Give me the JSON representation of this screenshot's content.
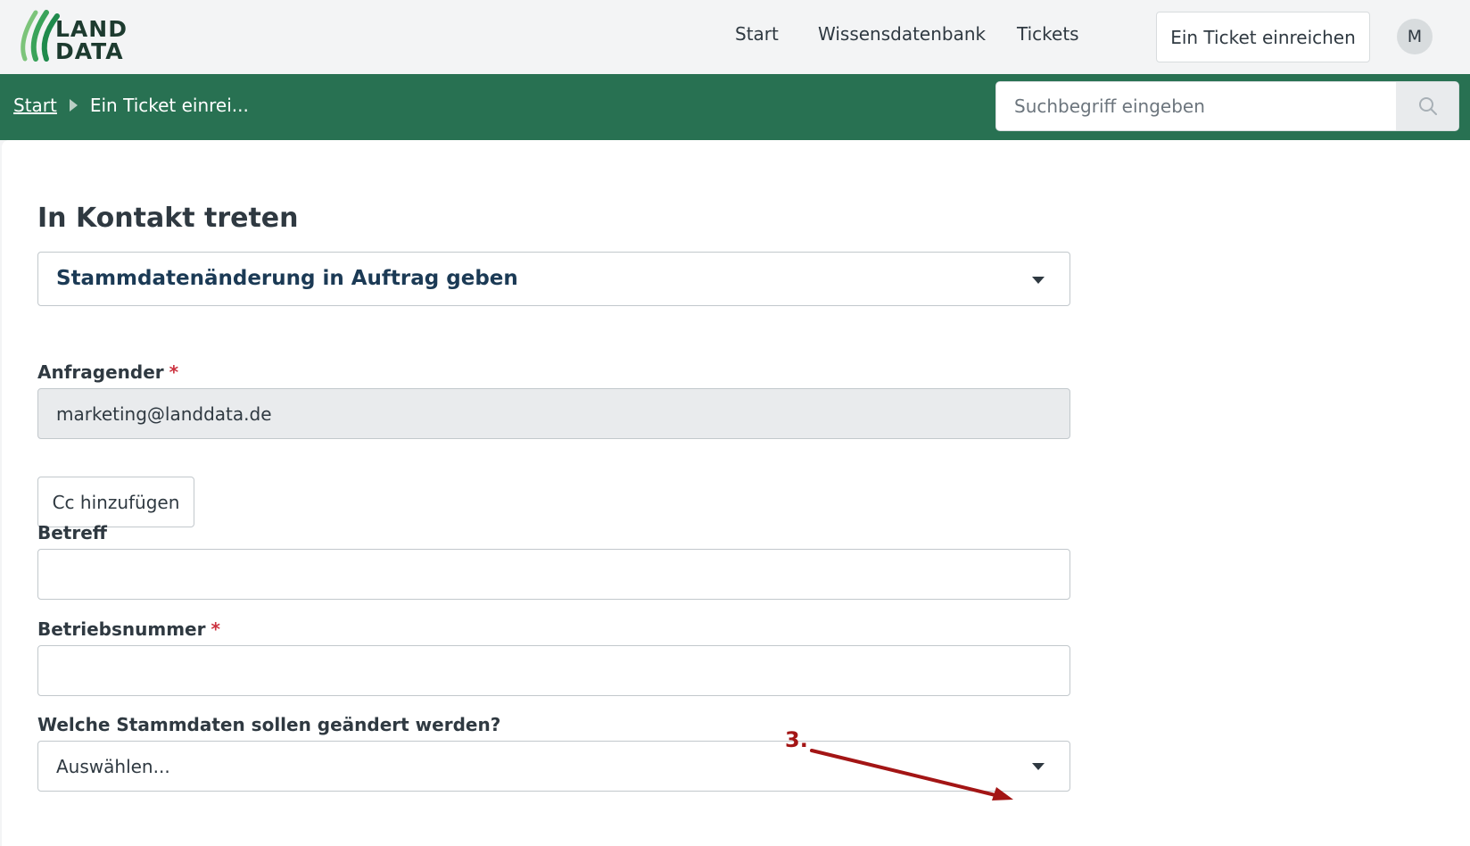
{
  "header": {
    "logo_line1": "LAND",
    "logo_line2": "DATA",
    "nav": {
      "start": "Start",
      "knowledge_base": "Wissensdatenbank",
      "tickets": "Tickets",
      "submit_ticket": "Ein Ticket einreichen"
    },
    "avatar_initial": "M"
  },
  "greenbar": {
    "breadcrumb_home": "Start",
    "breadcrumb_current": "Ein Ticket einrei...",
    "search_placeholder": "Suchbegriff eingeben"
  },
  "form": {
    "title": "In Kontakt treten",
    "form_type_selected": "Stammdatenänderung in Auftrag geben",
    "requester_label": "Anfragender",
    "requester_value": "marketing@landdata.de",
    "cc_button": "Cc hinzufügen",
    "subject_label": "Betreff",
    "subject_value": "",
    "farm_number_label": "Betriebsnummer",
    "farm_number_value": "",
    "master_data_label": "Welche Stammdaten sollen geändert werden?",
    "master_data_selected": "Auswählen...",
    "required_marker": "*"
  },
  "annotation": {
    "label": "3."
  },
  "colors": {
    "green_bar": "#287152",
    "required": "#cc3340",
    "annotation": "#a31515",
    "logo_green": "#3aa35a"
  },
  "icons": [
    "logo-icon",
    "search-icon",
    "breadcrumb-chevron-icon",
    "caret-down-icon",
    "annotation-arrow-icon"
  ]
}
